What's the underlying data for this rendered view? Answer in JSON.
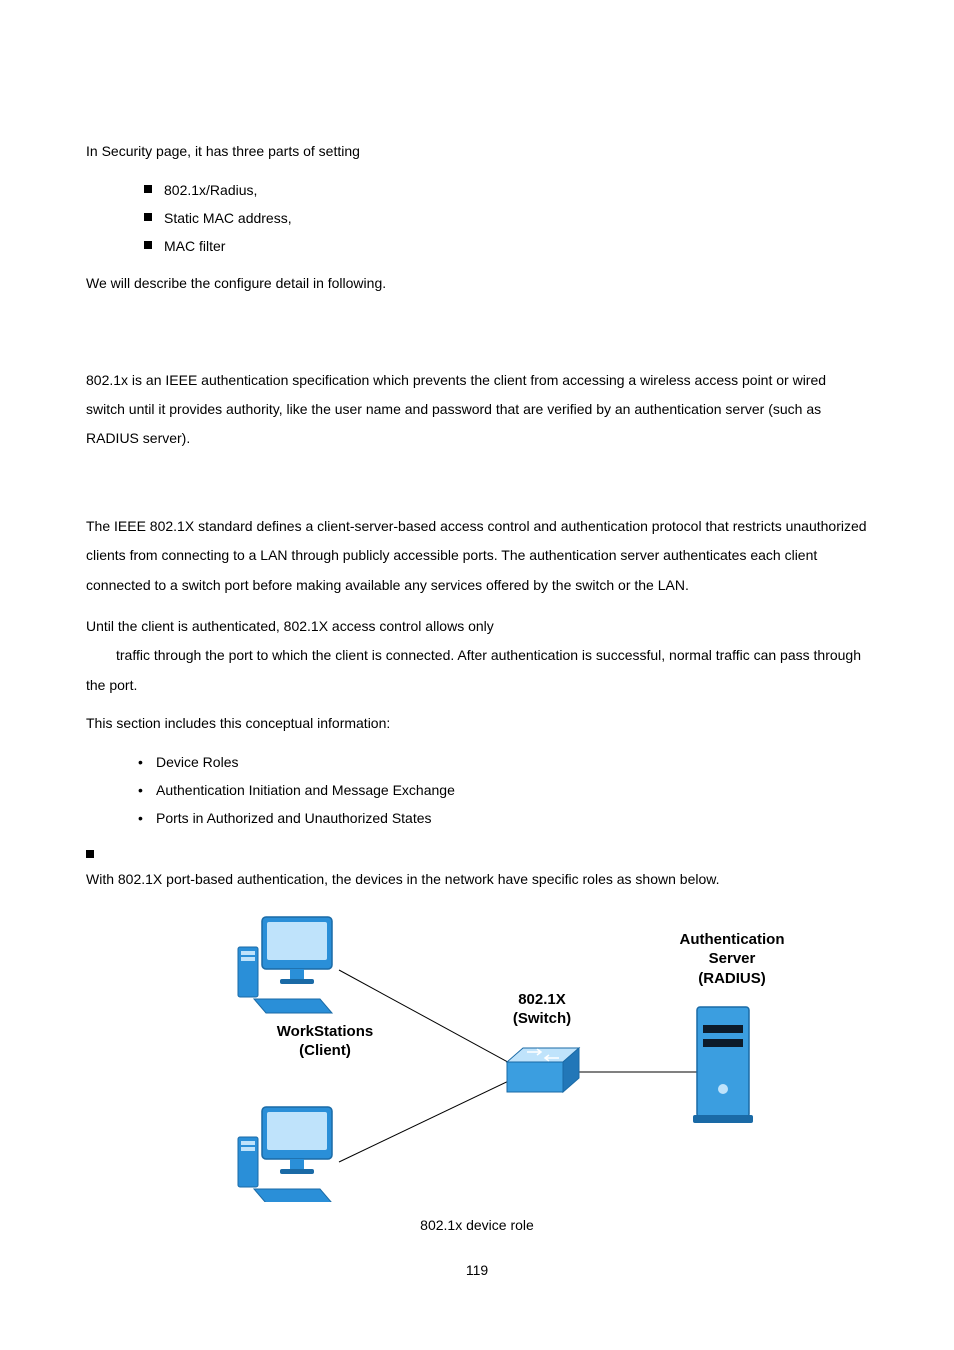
{
  "intro": "In Security page, it has three parts of setting",
  "parts": [
    "802.1x/Radius,",
    "Static MAC address,",
    "MAC filter"
  ],
  "intro_close": "We will describe the configure detail in following.",
  "p1": "802.1x is an IEEE authentication specification which prevents the client from accessing a wireless access point or wired switch until it provides authority, like the user name and password that are verified by an authentication server (such as RADIUS server).",
  "p2": "The IEEE 802.1X standard defines a client-server-based access control and authentication protocol that restricts unauthorized clients from connecting to a LAN through publicly accessible ports. The authentication server authenticates each client connected to a switch port before making available any services offered by the switch or the LAN.",
  "p3a": "Until the client is authenticated, 802.1X access control allows only",
  "p3b": "traffic through the port to which the client is connected. After authentication is successful, normal traffic can pass through the port.",
  "p4": "This section includes this conceptual information:",
  "concepts": [
    "Device Roles",
    "Authentication Initiation and Message Exchange",
    "Ports in Authorized and Unauthorized States"
  ],
  "p5": "With 802.1X port-based authentication, the devices in the network have specific roles as shown below.",
  "figure": {
    "client_label_l1": "WorkStations",
    "client_label_l2": "(Client)",
    "switch_label_l1": "802.1X",
    "switch_label_l2": "(Switch)",
    "server_label_l1": "Authentication",
    "server_label_l2": "Server",
    "server_label_l3": "(RADIUS)",
    "caption": "802.1x device role"
  },
  "page_number": "119"
}
